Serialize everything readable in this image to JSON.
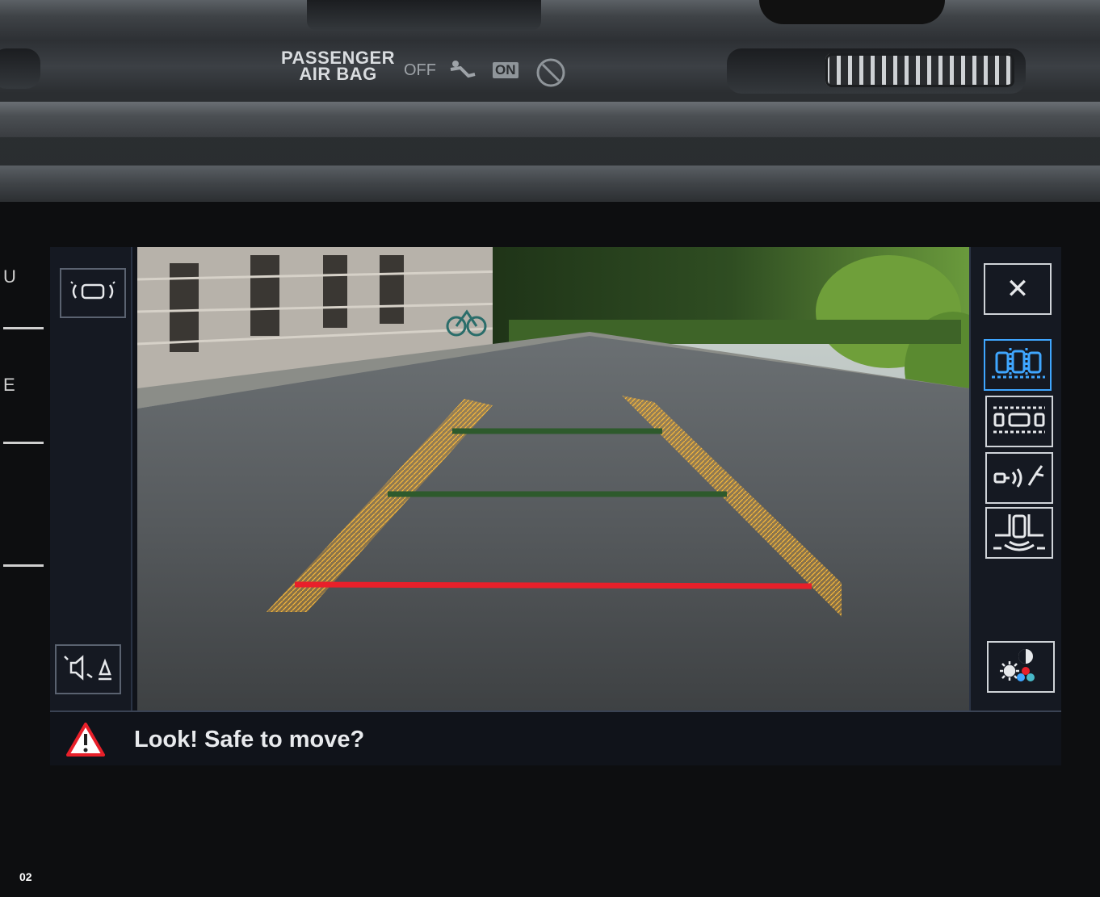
{
  "dashboard": {
    "airbag_label_line1": "PASSENGER",
    "airbag_label_line2": "AIR BAG",
    "airbag_off": "OFF",
    "airbag_on": "ON"
  },
  "side_buttons": [
    "U",
    "E"
  ],
  "camera": {
    "guide_colors": {
      "side": "#f0a830",
      "near": "#e8202a",
      "mid": "#2e5a2c"
    }
  },
  "left_panel": {
    "icons": [
      "park-sensor-icon",
      "mute-sound-icon"
    ]
  },
  "right_panel": {
    "close_label": "✕",
    "icons": [
      "parking-mode-rear-icon",
      "parking-mode-cross-icon",
      "trailer-assist-icon",
      "area-view-icon",
      "display-settings-icon"
    ],
    "active_index": 0,
    "accent": "#3fa6ff"
  },
  "message": {
    "text": "Look! Safe to move?"
  },
  "page_number": "02"
}
